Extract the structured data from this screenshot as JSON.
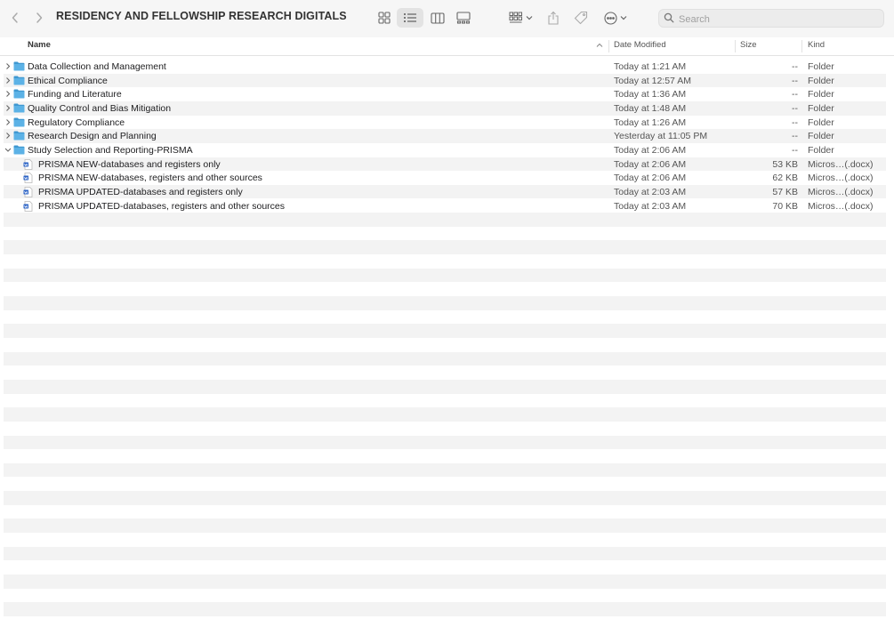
{
  "window": {
    "title": "RESIDENCY AND FELLOWSHIP RESEARCH DIGITALS"
  },
  "toolbar": {
    "back_icon": "chevron-left-icon",
    "forward_icon": "chevron-right-icon",
    "views": [
      "icon-view",
      "list-view",
      "column-view",
      "gallery-view"
    ],
    "active_view": "list-view",
    "search_placeholder": "Search"
  },
  "columns": {
    "name": "Name",
    "date": "Date Modified",
    "size": "Size",
    "kind": "Kind"
  },
  "rows": [
    {
      "name": "Data Collection and Management",
      "date": "Today at 1:21 AM",
      "size": "--",
      "kind": "Folder",
      "type": "folder",
      "expanded": false,
      "indent": 0
    },
    {
      "name": "Ethical Compliance",
      "date": "Today at 12:57 AM",
      "size": "--",
      "kind": "Folder",
      "type": "folder",
      "expanded": false,
      "indent": 0
    },
    {
      "name": "Funding and Literature",
      "date": "Today at 1:36 AM",
      "size": "--",
      "kind": "Folder",
      "type": "folder",
      "expanded": false,
      "indent": 0
    },
    {
      "name": "Quality Control and Bias Mitigation",
      "date": "Today at 1:48 AM",
      "size": "--",
      "kind": "Folder",
      "type": "folder",
      "expanded": false,
      "indent": 0
    },
    {
      "name": "Regulatory Compliance",
      "date": "Today at 1:26 AM",
      "size": "--",
      "kind": "Folder",
      "type": "folder",
      "expanded": false,
      "indent": 0
    },
    {
      "name": "Research Design and Planning",
      "date": "Yesterday at 11:05 PM",
      "size": "--",
      "kind": "Folder",
      "type": "folder",
      "expanded": false,
      "indent": 0
    },
    {
      "name": "Study Selection and Reporting-PRISMA",
      "date": "Today at 2:06 AM",
      "size": "--",
      "kind": "Folder",
      "type": "folder",
      "expanded": true,
      "indent": 0
    },
    {
      "name": "PRISMA NEW-databases and registers only",
      "date": "Today at 2:06 AM",
      "size": "53 KB",
      "kind": "Micros…(.docx)",
      "type": "docx",
      "expanded": false,
      "indent": 1
    },
    {
      "name": "PRISMA NEW-databases, registers and other sources",
      "date": "Today at 2:06 AM",
      "size": "62 KB",
      "kind": "Micros…(.docx)",
      "type": "docx",
      "expanded": false,
      "indent": 1
    },
    {
      "name": "PRISMA UPDATED-databases and registers only",
      "date": "Today at 2:03 AM",
      "size": "57 KB",
      "kind": "Micros…(.docx)",
      "type": "docx",
      "expanded": false,
      "indent": 1
    },
    {
      "name": "PRISMA UPDATED-databases, registers and other sources",
      "date": "Today at 2:03 AM",
      "size": "70 KB",
      "kind": "Micros…(.docx)",
      "type": "docx",
      "expanded": false,
      "indent": 1
    }
  ],
  "colors": {
    "folder": "#5cb2e6",
    "folder_tab": "#3f98d1",
    "doc_blue": "#2b63c6",
    "stripe": "#f3f3f3"
  }
}
